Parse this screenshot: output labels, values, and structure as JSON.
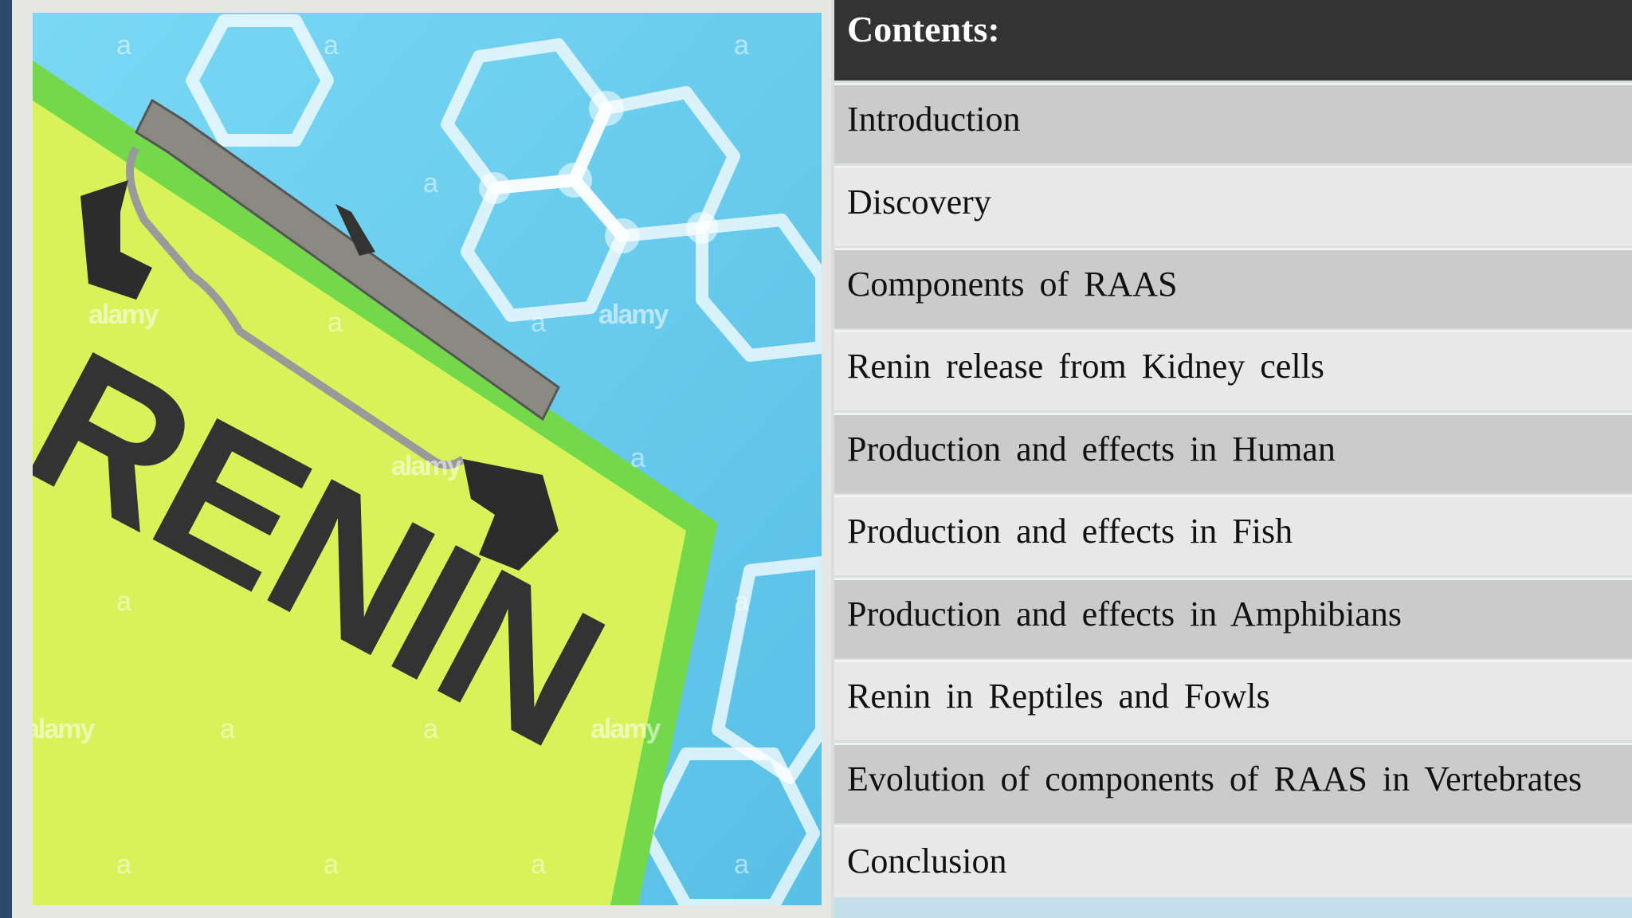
{
  "contents": {
    "heading": "Contents:",
    "items": [
      "Introduction",
      "Discovery",
      "Components of RAAS",
      "Renin release from Kidney cells",
      "Production and effects in Human",
      "Production and effects in Fish",
      "Production and effects in Amphibians",
      "Renin in Reptiles and Fowls",
      "Evolution of components of RAAS in Vertebrates",
      "Conclusion"
    ]
  },
  "photo": {
    "clipboard_text": "RENIN",
    "watermark": "alamy",
    "watermark_letter": "a",
    "colors": {
      "background": "#63c8ea",
      "clipboard": "#d9f25a",
      "clipboard_edge": "#74d94a",
      "text": "#333333"
    }
  },
  "colors": {
    "header_bg": "#333333",
    "row_dark": "#cbcbcb",
    "row_light": "#e8e8e8"
  }
}
